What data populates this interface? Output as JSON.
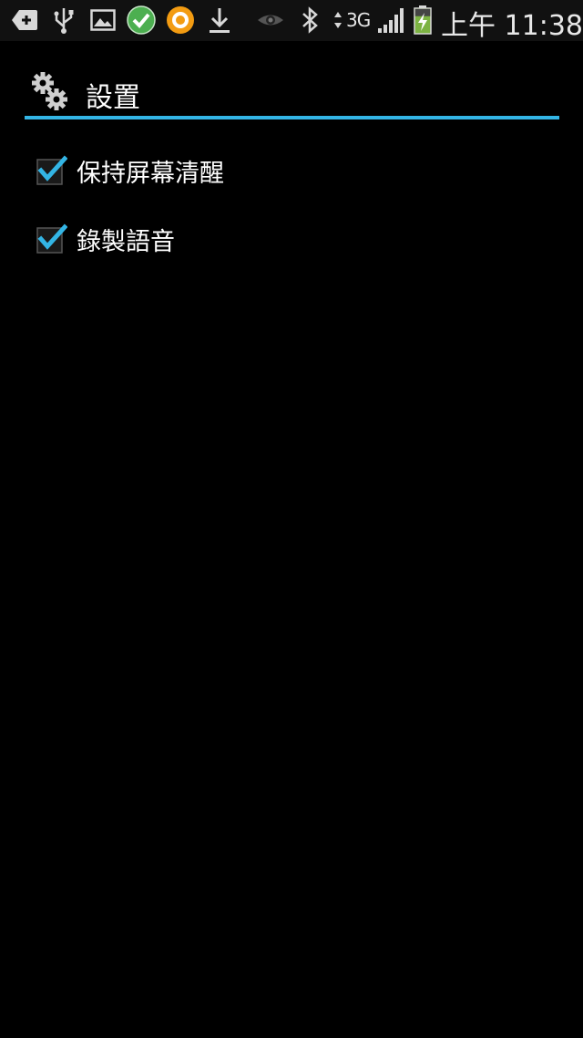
{
  "status_bar": {
    "network": "3G",
    "time": "上午 11:38",
    "icons": [
      "add-box-icon",
      "usb-icon",
      "image-icon",
      "check-circle-icon",
      "orange-app-icon",
      "download-icon",
      "eye-icon",
      "bluetooth-icon",
      "signal-icon",
      "battery-charging-icon"
    ]
  },
  "header": {
    "icon": "settings-gears-icon",
    "title": "設置",
    "accent_color": "#33b5e5"
  },
  "preferences": [
    {
      "label": "保持屏幕清醒",
      "checked": true
    },
    {
      "label": "錄製語音",
      "checked": true
    }
  ]
}
